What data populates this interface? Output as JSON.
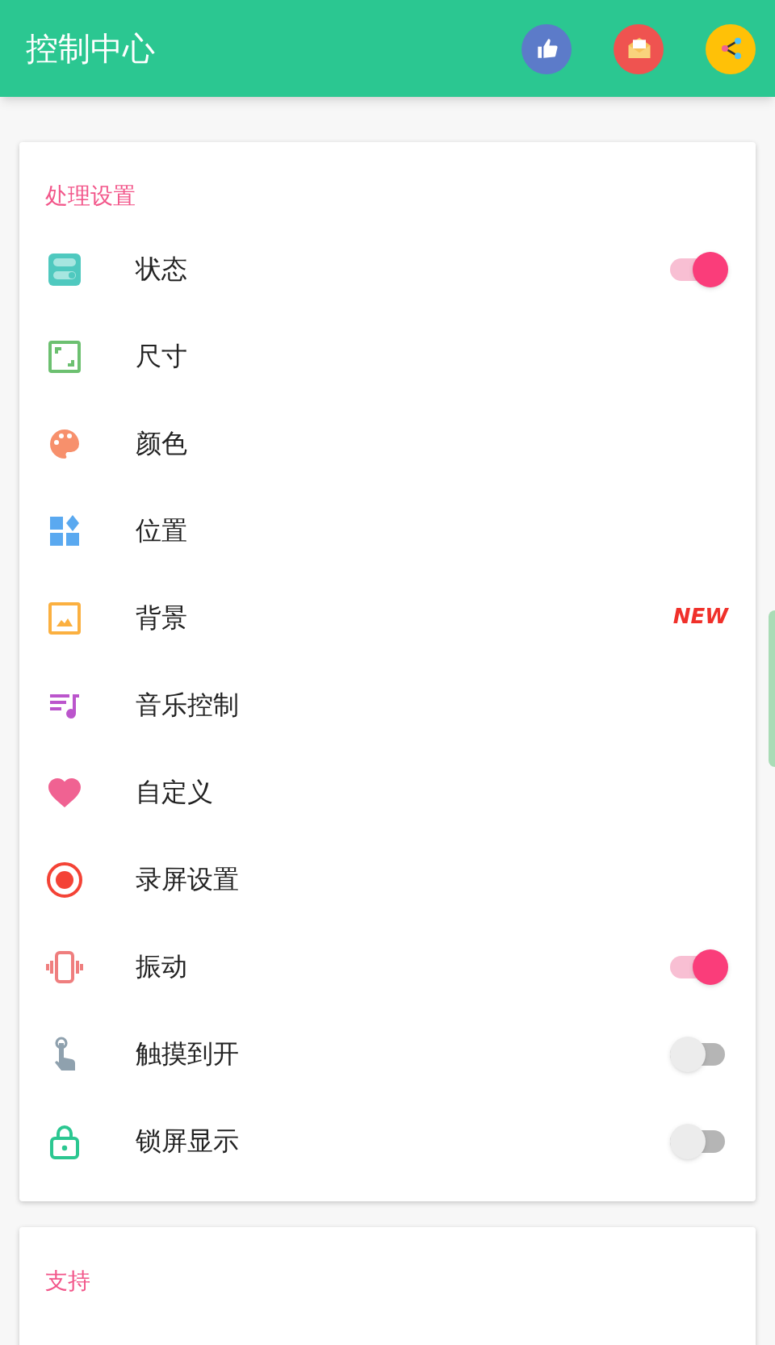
{
  "app_bar": {
    "title": "控制中心"
  },
  "sections": [
    {
      "title": "处理设置",
      "items": [
        {
          "label": "状态",
          "kind": "toggle",
          "on": true
        },
        {
          "label": "尺寸",
          "kind": "plain"
        },
        {
          "label": "颜色",
          "kind": "plain"
        },
        {
          "label": "位置",
          "kind": "plain"
        },
        {
          "label": "背景",
          "kind": "badge",
          "badge": "NEW"
        },
        {
          "label": "音乐控制",
          "kind": "plain"
        },
        {
          "label": "自定义",
          "kind": "plain"
        },
        {
          "label": "录屏设置",
          "kind": "plain"
        },
        {
          "label": "振动",
          "kind": "toggle",
          "on": true
        },
        {
          "label": "触摸到开",
          "kind": "toggle",
          "on": false
        },
        {
          "label": "锁屏显示",
          "kind": "toggle",
          "on": false
        }
      ]
    },
    {
      "title": "支持"
    }
  ]
}
